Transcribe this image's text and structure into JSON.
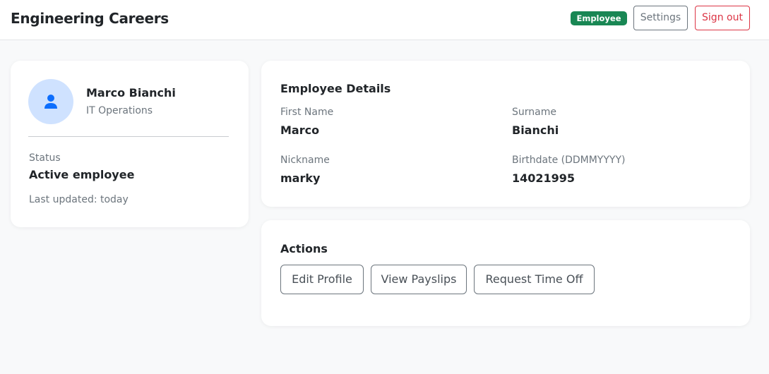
{
  "header": {
    "brand": "Engineering Careers",
    "role_badge": "Employee",
    "settings_label": "Settings",
    "signout_label": "Sign out"
  },
  "profile": {
    "avatar_icon": "user-icon",
    "name": "Marco Bianchi",
    "department": "IT Operations",
    "status_label": "Status",
    "status_value": "Active employee",
    "last_updated": "Last updated: today"
  },
  "details": {
    "title": "Employee Details",
    "fields": [
      {
        "label": "First Name",
        "value": "Marco"
      },
      {
        "label": "Surname",
        "value": "Bianchi"
      },
      {
        "label": "Nickname",
        "value": "marky"
      },
      {
        "label": "Birthdate (DDMMYYYY)",
        "value": "14021995"
      }
    ]
  },
  "actions": {
    "title": "Actions",
    "buttons": [
      {
        "label": "Edit Profile"
      },
      {
        "label": "View Payslips"
      },
      {
        "label": "Request Time Off"
      }
    ]
  },
  "colors": {
    "badge_green": "#198754",
    "danger_red": "#dc3545",
    "secondary_gray": "#6c757d",
    "avatar_bg": "#cfe2ff",
    "avatar_icon": "#0d6efd"
  }
}
